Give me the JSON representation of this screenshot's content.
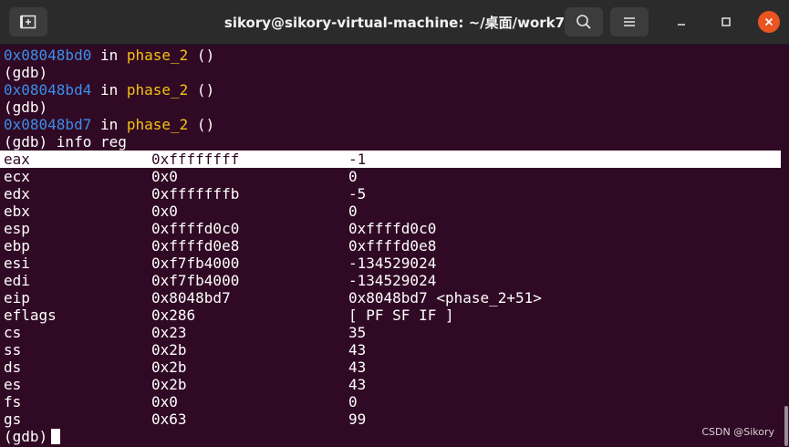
{
  "window": {
    "title": "sikory@sikory-virtual-machine: ~/桌面/work7"
  },
  "trace": [
    {
      "addr": "0x08048bd0",
      "in": " in ",
      "fn": "phase_2",
      "args": " ()"
    },
    {
      "prompt": "(gdb)"
    },
    {
      "addr": "0x08048bd4",
      "in": " in ",
      "fn": "phase_2",
      "args": " ()"
    },
    {
      "prompt": "(gdb)"
    },
    {
      "addr": "0x08048bd7",
      "in": " in ",
      "fn": "phase_2",
      "args": " ()"
    },
    {
      "prompt": "(gdb) info reg"
    }
  ],
  "registers": [
    {
      "name": "eax",
      "hex": "0xffffffff",
      "val": "-1"
    },
    {
      "name": "ecx",
      "hex": "0x0",
      "val": "0"
    },
    {
      "name": "edx",
      "hex": "0xfffffffb",
      "val": "-5"
    },
    {
      "name": "ebx",
      "hex": "0x0",
      "val": "0"
    },
    {
      "name": "esp",
      "hex": "0xffffd0c0",
      "val": "0xffffd0c0"
    },
    {
      "name": "ebp",
      "hex": "0xffffd0e8",
      "val": "0xffffd0e8"
    },
    {
      "name": "esi",
      "hex": "0xf7fb4000",
      "val": "-134529024"
    },
    {
      "name": "edi",
      "hex": "0xf7fb4000",
      "val": "-134529024"
    },
    {
      "name": "eip",
      "hex": "0x8048bd7",
      "val": "0x8048bd7 <phase_2+51>"
    },
    {
      "name": "eflags",
      "hex": "0x286",
      "val": "[ PF SF IF ]"
    },
    {
      "name": "cs",
      "hex": "0x23",
      "val": "35"
    },
    {
      "name": "ss",
      "hex": "0x2b",
      "val": "43"
    },
    {
      "name": "ds",
      "hex": "0x2b",
      "val": "43"
    },
    {
      "name": "es",
      "hex": "0x2b",
      "val": "43"
    },
    {
      "name": "fs",
      "hex": "0x0",
      "val": "0"
    },
    {
      "name": "gs",
      "hex": "0x63",
      "val": "99"
    }
  ],
  "final_prompt": "(gdb)",
  "watermark": "CSDN @Sikory",
  "colors": {
    "background": "#300a24",
    "address": "#3b8eea",
    "function": "#f5c211",
    "close_button": "#e95420"
  }
}
